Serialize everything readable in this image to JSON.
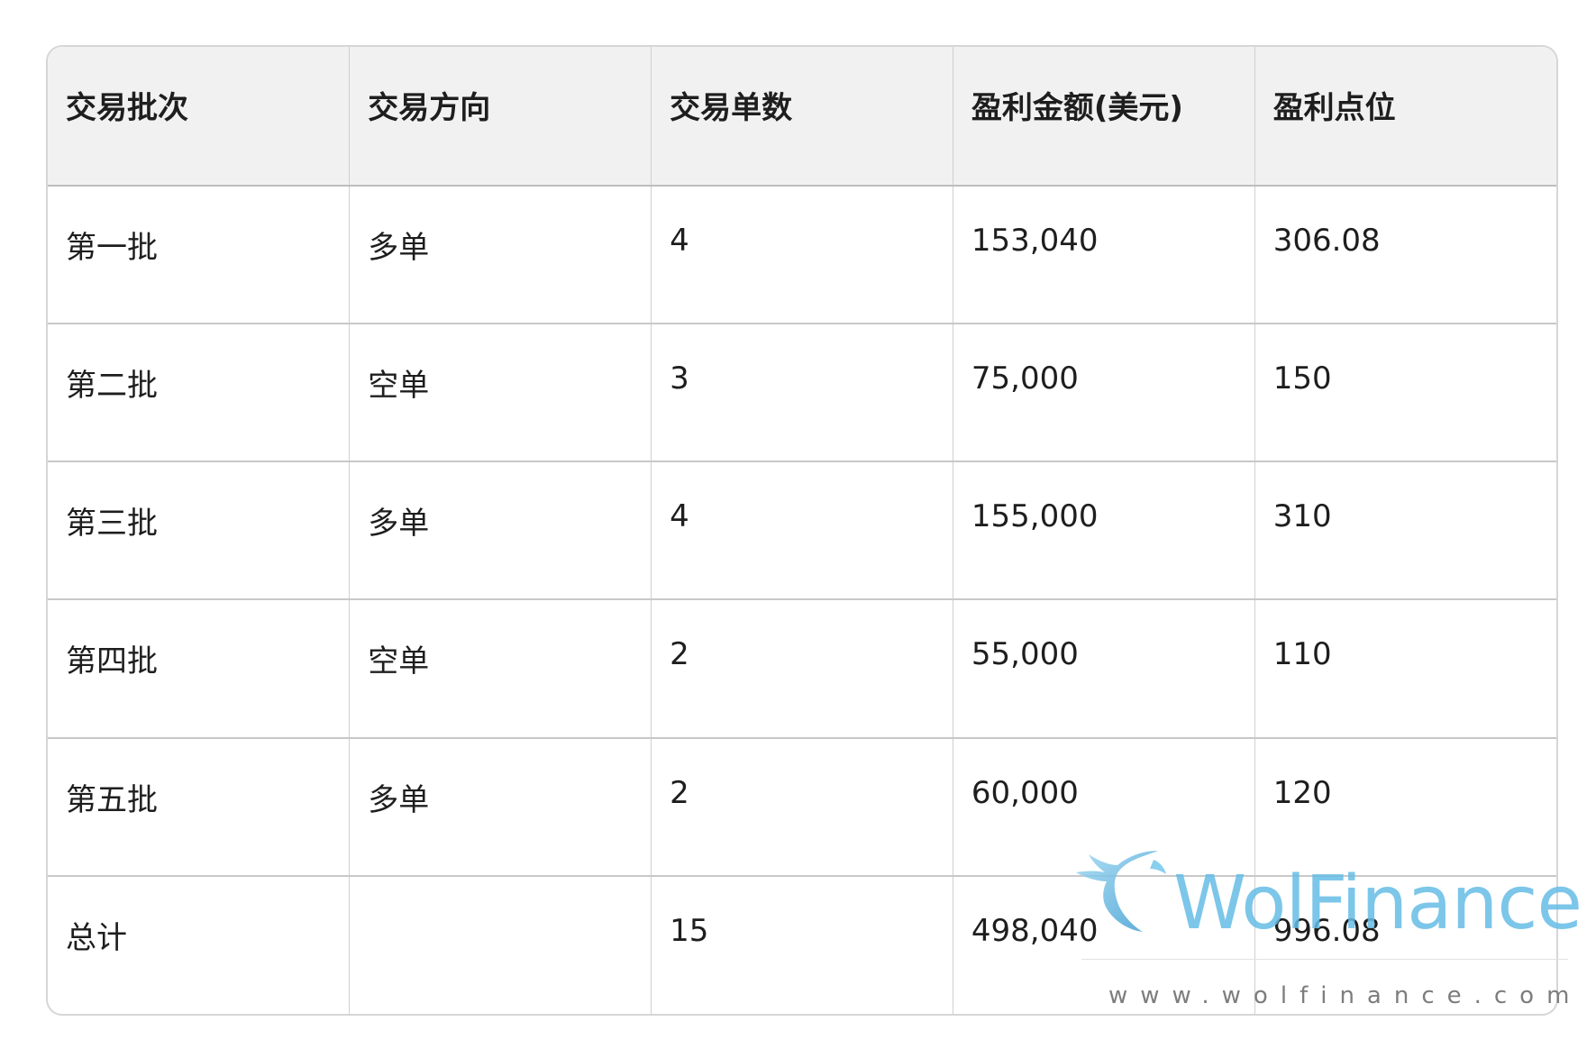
{
  "table": {
    "headers": [
      "交易批次",
      "交易方向",
      "交易单数",
      "盈利金额(美元)",
      "盈利点位"
    ],
    "rows": [
      [
        "第一批",
        "多单",
        "4",
        "153,040",
        "306.08"
      ],
      [
        "第二批",
        "空单",
        "3",
        "75,000",
        "150"
      ],
      [
        "第三批",
        "多单",
        "4",
        "155,000",
        "310"
      ],
      [
        "第四批",
        "空单",
        "2",
        "55,000",
        "110"
      ],
      [
        "第五批",
        "多单",
        "2",
        "60,000",
        "120"
      ],
      [
        "总计",
        "",
        "15",
        "498,040",
        "996.08"
      ]
    ]
  },
  "watermark": {
    "brand": "WolFinance",
    "url": "www.wolfinance.com",
    "color": "#66bde6",
    "icon": "wolf-logo-icon"
  }
}
